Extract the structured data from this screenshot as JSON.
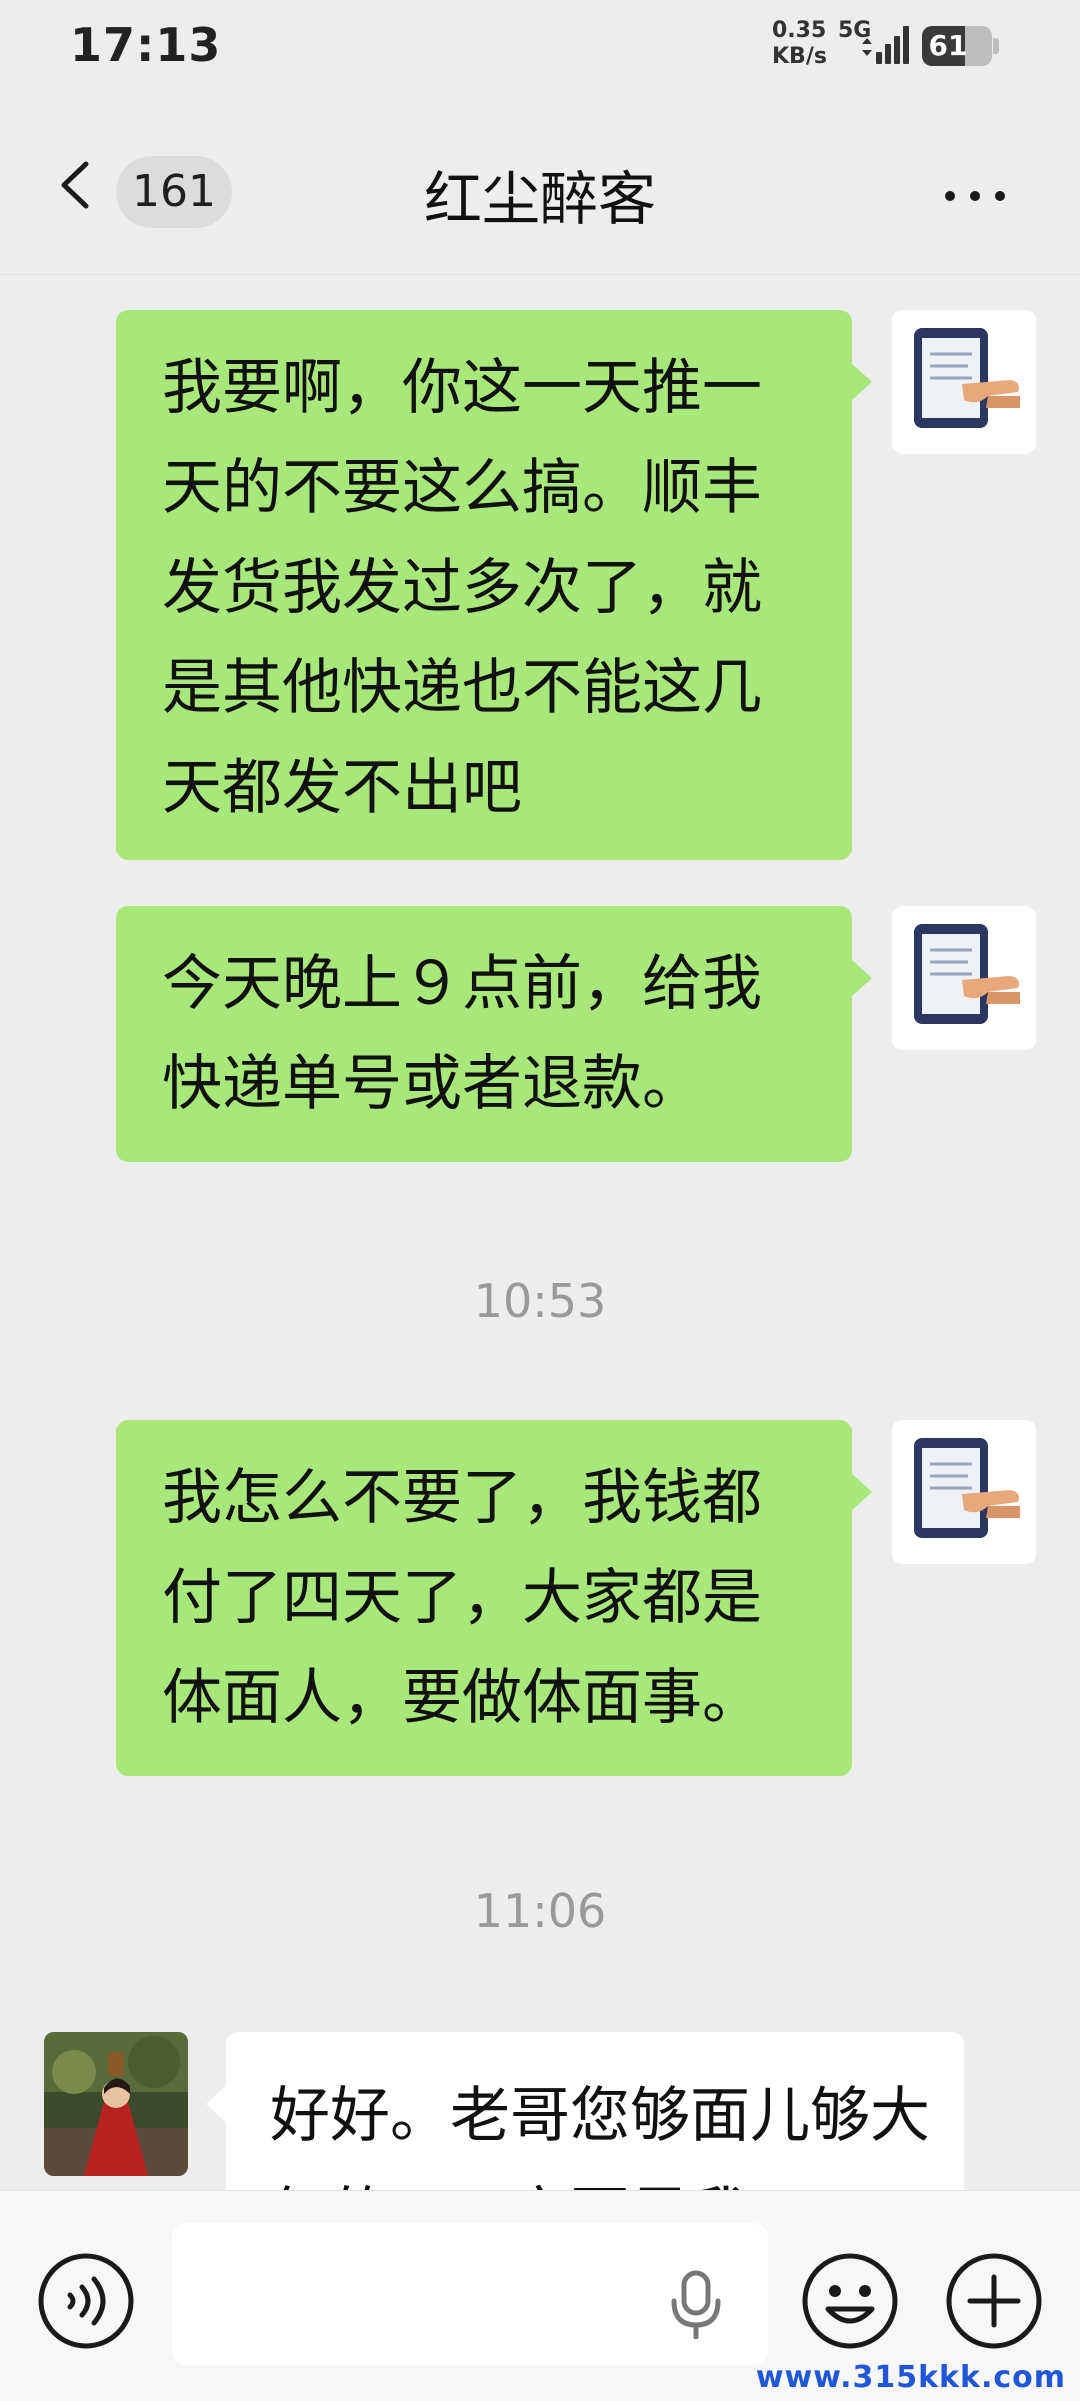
{
  "status_bar": {
    "time": "17:13",
    "net_speed_value": "0.35",
    "net_speed_unit": "KB/s",
    "network_type": "5G",
    "battery_level": "61",
    "battery_fraction": 0.61
  },
  "header": {
    "unread_count": "161",
    "title": "红尘醉客",
    "icons": {
      "back": "chevron-left-icon",
      "more": "more-dots-icon"
    }
  },
  "messages": [
    {
      "side": "out",
      "text": "我要啊，你这一天推一天的不要这么搞。顺丰发货我发过多次了，就是其他快递也不能这几天都发不出吧"
    },
    {
      "side": "out",
      "text": "今天晚上９点前，给我快递单号或者退款。"
    },
    {
      "timestamp": "10:53"
    },
    {
      "side": "out",
      "text": "我怎么不要了，我钱都付了四天了，大家都是体面人，要做体面事。"
    },
    {
      "timestamp": "11:06"
    },
    {
      "side": "in",
      "text": "好好。老哥您够面儿够大气的，一定要是我"
    }
  ],
  "input_bar": {
    "placeholder": "",
    "icons": {
      "voice": "voice-wave-icon",
      "mic": "microphone-icon",
      "emoji": "emoji-smile-icon",
      "more": "plus-circle-icon"
    }
  },
  "watermark": "www.315kkk.com",
  "colors": {
    "bubble_out": "#a8e87b",
    "bubble_in": "#ffffff",
    "background": "#ededed"
  }
}
